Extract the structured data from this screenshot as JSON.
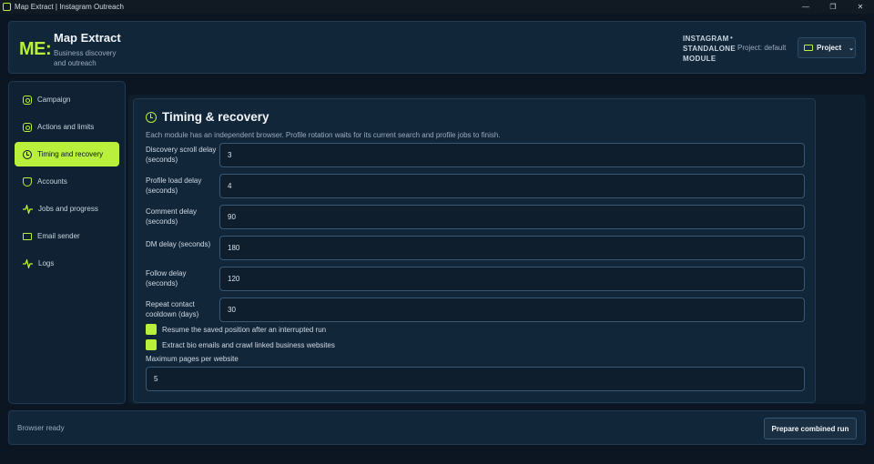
{
  "window": {
    "title": "Map Extract | Instagram Outreach",
    "min": "—",
    "max": "❐",
    "close": "✕"
  },
  "header": {
    "logo": "ME:",
    "title": "Map Extract",
    "subtitle": "Business discovery and outreach",
    "module": "INSTAGRAM STANDALONE MODULE",
    "dot": "•",
    "project_text": "Project: default",
    "project_button": "Project",
    "chevron": "⌄"
  },
  "sidebar": {
    "items": [
      {
        "label": "Campaign",
        "icon": "instagram-icon"
      },
      {
        "label": "Actions and limits",
        "icon": "instagram-icon"
      },
      {
        "label": "Timing and recovery",
        "icon": "clock-icon",
        "active": true
      },
      {
        "label": "Accounts",
        "icon": "shield-check-icon"
      },
      {
        "label": "Jobs and progress",
        "icon": "pulse-icon"
      },
      {
        "label": "Email sender",
        "icon": "mail-icon"
      },
      {
        "label": "Logs",
        "icon": "pulse-icon"
      }
    ]
  },
  "card": {
    "title": "Timing & recovery",
    "description": "Each module has an independent browser. Profile rotation waits for its current search and profile jobs to finish.",
    "fields": [
      {
        "label": "Discovery scroll delay (seconds)",
        "value": "3"
      },
      {
        "label": "Profile load delay (seconds)",
        "value": "4"
      },
      {
        "label": "Comment delay (seconds)",
        "value": "90"
      },
      {
        "label": "DM delay (seconds)",
        "value": "180"
      },
      {
        "label": "Follow delay (seconds)",
        "value": "120"
      },
      {
        "label": "Repeat contact cooldown (days)",
        "value": "30"
      }
    ],
    "checkboxes": [
      {
        "label": "Resume the saved position after an interrupted run",
        "checked": true
      },
      {
        "label": "Extract bio emails and crawl linked business websites",
        "checked": true
      }
    ],
    "max_pages_label": "Maximum pages per website",
    "max_pages_value": "5"
  },
  "footer": {
    "status": "Browser ready",
    "run_button": "Prepare combined run"
  },
  "colors": {
    "accent": "#b8f03c",
    "background": "#0b1622",
    "panel": "#12263a"
  }
}
